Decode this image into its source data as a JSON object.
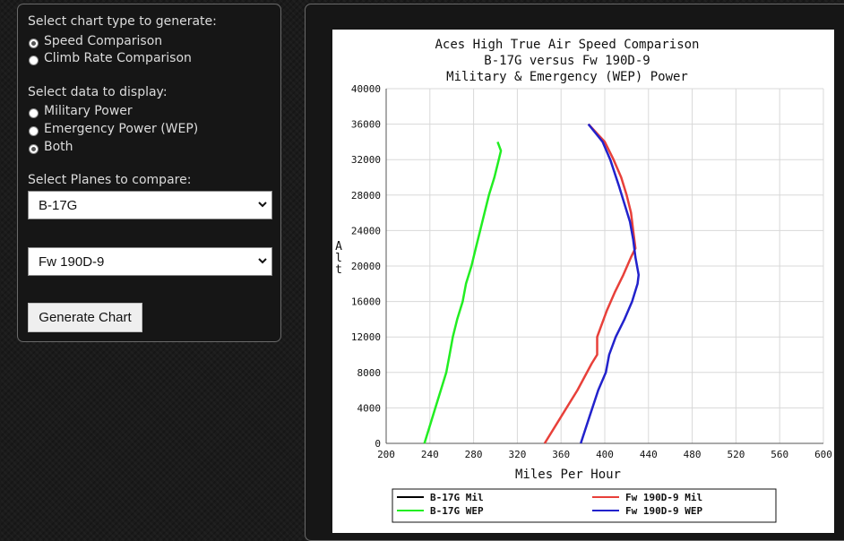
{
  "controls": {
    "chart_type_heading": "Select chart type to generate:",
    "chart_types": [
      {
        "label": "Speed Comparison",
        "checked": true
      },
      {
        "label": "Climb Rate Comparison",
        "checked": false
      }
    ],
    "data_heading": "Select data to display:",
    "data_options": [
      {
        "label": "Military Power",
        "checked": false
      },
      {
        "label": "Emergency Power (WEP)",
        "checked": false
      },
      {
        "label": "Both",
        "checked": true
      }
    ],
    "planes_heading": "Select Planes to compare:",
    "plane1": "B-17G",
    "plane2": "Fw 190D-9",
    "generate_label": "Generate Chart"
  },
  "chart_data": {
    "type": "line",
    "title": "Aces High True Air Speed Comparison",
    "subtitle": "B-17G versus Fw 190D-9",
    "subtitle2": "Military & Emergency (WEP) Power",
    "xlabel": "Miles Per Hour",
    "ylabel": "Alt",
    "xlim": [
      200,
      600
    ],
    "ylim": [
      0,
      40000
    ],
    "xticks": [
      200,
      240,
      280,
      320,
      360,
      400,
      440,
      480,
      520,
      560,
      600
    ],
    "yticks": [
      0,
      4000,
      8000,
      12000,
      16000,
      20000,
      24000,
      28000,
      32000,
      36000,
      40000
    ],
    "grid": true,
    "legend_position": "bottom",
    "series": [
      {
        "name": "B-17G Mil",
        "color": "#000000",
        "points": []
      },
      {
        "name": "Fw 190D-9 Mil",
        "color": "#e8403a",
        "points": [
          [
            345,
            0
          ],
          [
            360,
            3000
          ],
          [
            375,
            6000
          ],
          [
            388,
            9000
          ],
          [
            393,
            10000
          ],
          [
            393,
            12000
          ],
          [
            396,
            13000
          ],
          [
            402,
            15000
          ],
          [
            409,
            17000
          ],
          [
            417,
            19000
          ],
          [
            424,
            21000
          ],
          [
            428,
            22000
          ],
          [
            426,
            24000
          ],
          [
            424,
            26000
          ],
          [
            420,
            28000
          ],
          [
            415,
            30000
          ],
          [
            408,
            32000
          ],
          [
            400,
            34000
          ],
          [
            385,
            36000
          ]
        ]
      },
      {
        "name": "B-17G WEP",
        "color": "#22ee22",
        "points": [
          [
            235,
            0
          ],
          [
            240,
            2000
          ],
          [
            245,
            4000
          ],
          [
            250,
            6000
          ],
          [
            255,
            8000
          ],
          [
            258,
            10000
          ],
          [
            261,
            12000
          ],
          [
            265,
            14000
          ],
          [
            270,
            16000
          ],
          [
            273,
            18000
          ],
          [
            278,
            20000
          ],
          [
            282,
            22000
          ],
          [
            286,
            24000
          ],
          [
            290,
            26000
          ],
          [
            294,
            28000
          ],
          [
            299,
            30000
          ],
          [
            303,
            32000
          ],
          [
            305,
            33000
          ],
          [
            302,
            34000
          ]
        ]
      },
      {
        "name": "Fw 190D-9 WEP",
        "color": "#2222cc",
        "points": [
          [
            378,
            0
          ],
          [
            386,
            3000
          ],
          [
            394,
            6000
          ],
          [
            401,
            8000
          ],
          [
            404,
            10000
          ],
          [
            410,
            12000
          ],
          [
            418,
            14000
          ],
          [
            425,
            16000
          ],
          [
            430,
            18000
          ],
          [
            431,
            19000
          ],
          [
            428,
            21000
          ],
          [
            426,
            23000
          ],
          [
            423,
            25000
          ],
          [
            418,
            27000
          ],
          [
            413,
            29000
          ],
          [
            405,
            32000
          ],
          [
            398,
            34000
          ],
          [
            385,
            36000
          ]
        ]
      }
    ]
  }
}
